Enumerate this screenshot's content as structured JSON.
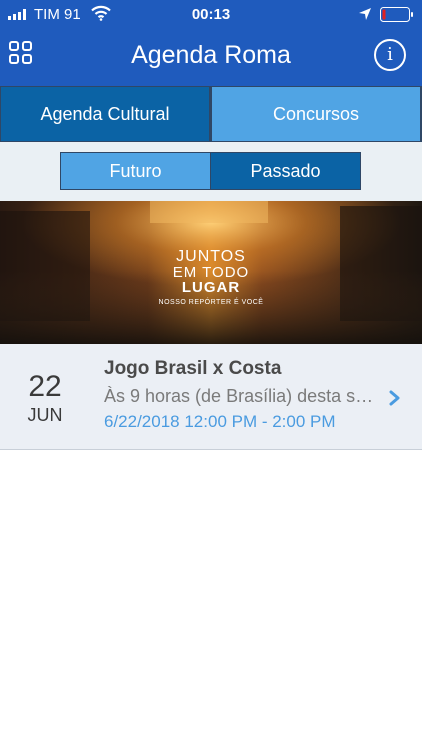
{
  "status_bar": {
    "carrier": "TIM 91",
    "time": "00:13"
  },
  "nav": {
    "title": "Agenda Roma",
    "info_glyph": "i"
  },
  "tabs": [
    {
      "label": "Agenda Cultural",
      "active": true
    },
    {
      "label": "Concursos",
      "active": false
    }
  ],
  "subtabs": [
    {
      "label": "Futuro",
      "active": false
    },
    {
      "label": "Passado",
      "active": true
    }
  ],
  "banner": {
    "line1": "JUNTOS",
    "line2": "EM TODO",
    "line3": "LUGAR",
    "line4": "NOSSO REPÓRTER É VOCÊ"
  },
  "events": [
    {
      "day": "22",
      "month": "JUN",
      "title": "Jogo Brasil x Costa",
      "description": "Às 9 horas (de Brasília) desta s…",
      "date_range": "6/22/2018 12:00 PM - 2:00 PM"
    }
  ],
  "colors": {
    "header": "#1f5bbd",
    "tab_dark": "#0b63a5",
    "tab_light": "#50a4e4",
    "link_blue": "#4a9be0",
    "row_bg": "#ebeff5"
  },
  "icons": {
    "signal": "cellular-signal-icon",
    "wifi": "wifi-icon",
    "location": "location-arrow-icon",
    "battery": "battery-low-icon",
    "grid": "grid-menu-icon",
    "info": "info-icon",
    "chevron": "chevron-right-icon"
  }
}
